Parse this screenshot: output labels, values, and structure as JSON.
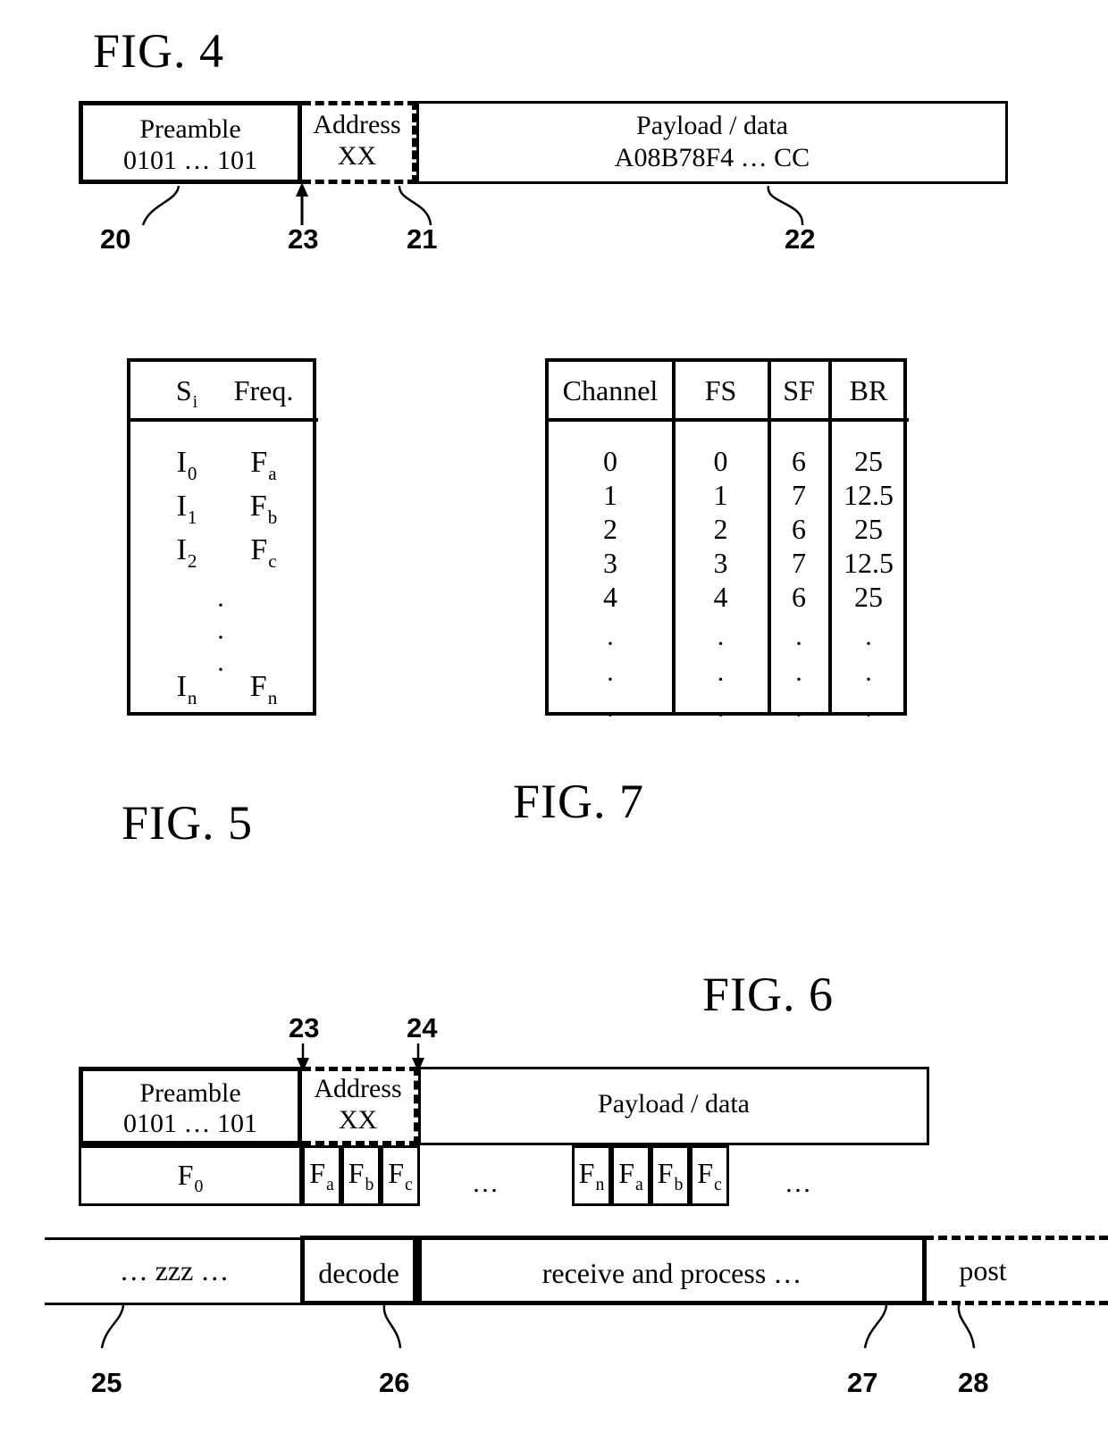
{
  "figures": {
    "fig4": {
      "title": "FIG. 4",
      "packet": {
        "preamble": {
          "line1": "Preamble",
          "line2": "0101 … 101"
        },
        "address": {
          "line1": "Address",
          "line2": "XX"
        },
        "payload": {
          "line1": "Payload / data",
          "line2": "A08B78F4 … CC"
        }
      },
      "refs": {
        "preamble": "20",
        "sync_point": "23",
        "address": "21",
        "payload": "22"
      }
    },
    "fig5": {
      "title": "FIG. 5",
      "headers": [
        "S",
        "Freq."
      ],
      "header_sub": "i",
      "rows": [
        {
          "si": "I",
          "si_sub": "0",
          "freq": "F",
          "freq_sub": "a"
        },
        {
          "si": "I",
          "si_sub": "1",
          "freq": "F",
          "freq_sub": "b"
        },
        {
          "si": "I",
          "si_sub": "2",
          "freq": "F",
          "freq_sub": "c"
        },
        {
          "si": "I",
          "si_sub": "n",
          "freq": "F",
          "freq_sub": "n"
        }
      ],
      "ellipsis": "·\n·\n·"
    },
    "fig7": {
      "title": "FIG. 7",
      "columns": [
        "Channel",
        "FS",
        "SF",
        "BR"
      ],
      "rows": [
        [
          "0",
          "0",
          "6",
          "25"
        ],
        [
          "1",
          "1",
          "7",
          "12.5"
        ],
        [
          "2",
          "2",
          "6",
          "25"
        ],
        [
          "3",
          "3",
          "7",
          "12.5"
        ],
        [
          "4",
          "4",
          "6",
          "25"
        ]
      ],
      "ellipsis": "·\n·\n·"
    },
    "fig6": {
      "title": "FIG. 6",
      "packet": {
        "preamble": {
          "line1": "Preamble",
          "line2": "0101 … 101"
        },
        "address": {
          "line1": "Address",
          "line2": "XX"
        },
        "payload": {
          "line1": "Payload / data"
        }
      },
      "freq_row": {
        "base": {
          "label": "F",
          "sub": "0"
        },
        "group1": [
          {
            "label": "F",
            "sub": "a"
          },
          {
            "label": "F",
            "sub": "b"
          },
          {
            "label": "F",
            "sub": "c"
          }
        ],
        "gap1": "…",
        "group2": [
          {
            "label": "F",
            "sub": "n"
          },
          {
            "label": "F",
            "sub": "a"
          },
          {
            "label": "F",
            "sub": "b"
          },
          {
            "label": "F",
            "sub": "c"
          }
        ],
        "gap2": "…"
      },
      "timeline": {
        "idle": "… zzz …",
        "decode": "decode",
        "process": "receive and process …",
        "post": "post"
      },
      "refs": {
        "sync_start": "23",
        "sync_end": "24",
        "idle": "25",
        "decode": "26",
        "process": "27",
        "post": "28"
      }
    }
  }
}
